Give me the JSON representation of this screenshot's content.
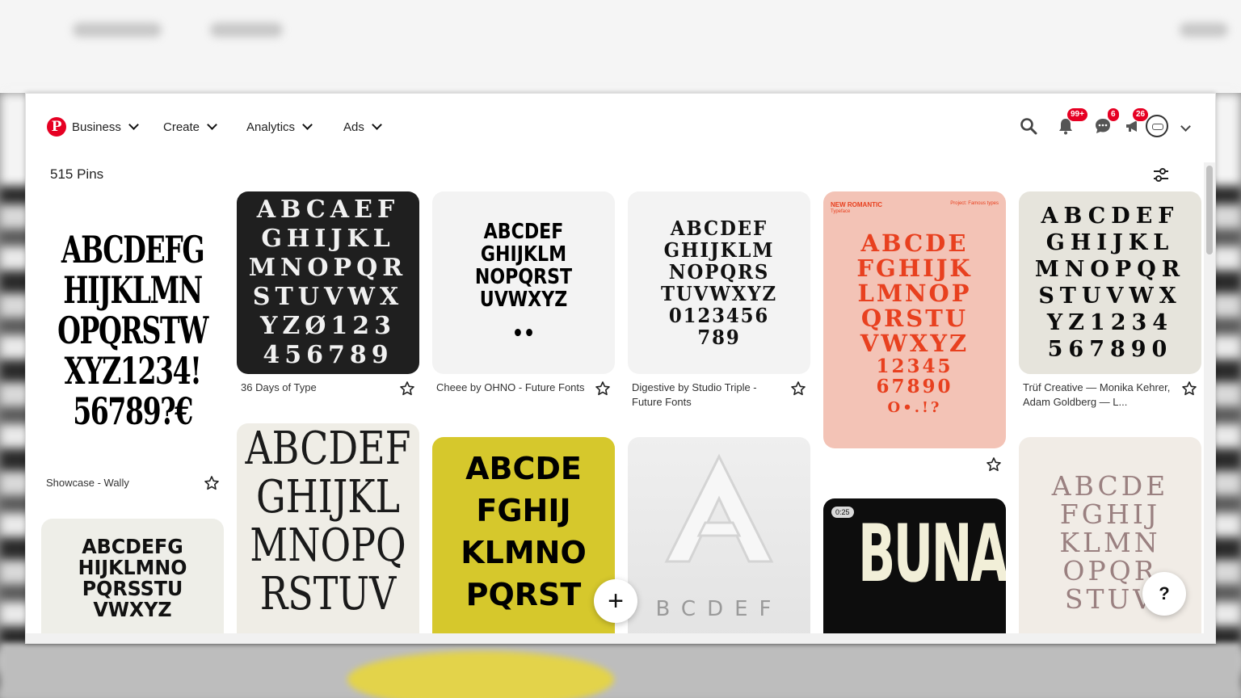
{
  "nav": {
    "logo_glyph": "P",
    "items": [
      {
        "label": "Business"
      },
      {
        "label": "Create"
      },
      {
        "label": "Analytics"
      },
      {
        "label": "Ads"
      }
    ],
    "notifications_badge": "99+",
    "messages_badge": "6",
    "updates_badge": "26"
  },
  "board": {
    "pin_count": "515 Pins"
  },
  "pins": [
    {
      "title": "Showcase - Wally",
      "glyphs": [
        "ABCDEFG",
        "HIJKLMN",
        "OPQRSTW",
        "XYZ1234!",
        "56789?€"
      ]
    },
    {
      "title": "36 Days of Type",
      "glyphs": [
        "ABCAEF",
        "GHIJKL",
        "MNOPQR",
        "STUVWX",
        "YZØ123",
        "456789"
      ]
    },
    {
      "title": "Cheee by OHNO - Future Fonts",
      "glyphs": [
        "ABCDEF",
        "GHIJKLM",
        "NOPQRST",
        "UVWXYZ",
        "••"
      ]
    },
    {
      "title": "Digestive by Studio Triple - Future Fonts",
      "glyphs": [
        "ABCDEF",
        "GHIJKLM",
        "NOPQRS",
        "TUVWXYZ",
        "0123456",
        "789"
      ]
    },
    {
      "title": "",
      "header_left": "NEW ROMANTIC",
      "header_sub": "Typeface",
      "header_right": "Project: Famous types",
      "glyphs": [
        "ABCDE",
        "FGHIJK",
        "LMNOP",
        "QRSTU",
        "VWXYZ",
        "12345",
        "67890",
        "O•.!?"
      ]
    },
    {
      "title": "Trüf Creative — Monika Kehrer, Adam Goldberg — L...",
      "glyphs": [
        "ABCDEF",
        "GHIJKL",
        "MNOPQR",
        "STUVWX",
        "YZ1234",
        "567890"
      ]
    },
    {
      "title": "",
      "glyphs": [
        "ABCDEFG",
        "HIJKLMNO",
        "PQRSSTU",
        "VWXYZ"
      ]
    },
    {
      "title": "",
      "glyphs": [
        "ABCDEF",
        "GHIJKL",
        "MNOPQ",
        "RSTUV"
      ]
    },
    {
      "title": "",
      "glyphs": [
        "ABCDE",
        "FGHIJ",
        "KLMNO",
        "PQRST"
      ]
    },
    {
      "title": "",
      "big_glyph": "A",
      "glyphs": [
        "BCDEF"
      ]
    },
    {
      "title": "",
      "video_time": "0:25",
      "glyphs": [
        "BUNA"
      ]
    },
    {
      "title": "",
      "glyphs": [
        "ABCDE",
        "FGHIJ",
        "KLMN",
        "OPQR",
        "STUV"
      ]
    }
  ],
  "buttons": {
    "add_glyph": "+",
    "help_glyph": "?"
  },
  "colors": {
    "brand": "#e60023",
    "romantic_bg": "#f3c3b6",
    "romantic_text": "#e8401f",
    "yellow_card": "#d6c82c"
  }
}
